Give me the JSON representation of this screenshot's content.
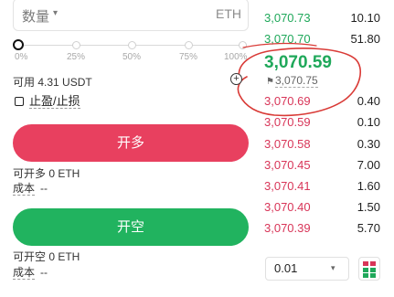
{
  "quantity": {
    "label": "数量",
    "caret": "▾",
    "unit": "ETH"
  },
  "slider": {
    "ticks": [
      "0%",
      "25%",
      "50%",
      "75%",
      "100%"
    ],
    "value_percent": 0
  },
  "available": "可用 4.31 USDT",
  "tpsl": {
    "label": "止盈/止损",
    "checked": false
  },
  "long": {
    "button_label": "开多",
    "can_open": "可开多 0 ETH",
    "cost_label": "成本",
    "cost_value": "--"
  },
  "short": {
    "button_label": "开空",
    "can_open": "可开空 0 ETH",
    "cost_label": "成本",
    "cost_value": "--"
  },
  "orderbook": {
    "asks": [
      {
        "price": "3,070.73",
        "amount": "10.10"
      },
      {
        "price": "3,070.70",
        "amount": "51.80"
      }
    ],
    "last_price": "3,070.59",
    "mark_price": "3,070.75",
    "bids": [
      {
        "price": "3,070.69",
        "amount": "0.40"
      },
      {
        "price": "3,070.59",
        "amount": "0.10"
      },
      {
        "price": "3,070.58",
        "amount": "0.30"
      },
      {
        "price": "3,070.45",
        "amount": "7.00"
      },
      {
        "price": "3,070.41",
        "amount": "1.60"
      },
      {
        "price": "3,070.40",
        "amount": "1.50"
      },
      {
        "price": "3,070.39",
        "amount": "5.70"
      }
    ],
    "precision": "0.01",
    "precision_caret": "▾"
  },
  "colors": {
    "bid_red": "#d83558",
    "ask_green": "#1fa85a",
    "long_button": "#e8405f",
    "short_button": "#21b35f",
    "annotation": "#d93a36"
  },
  "icons": {
    "plus": "plus-circle-icon",
    "flag": "flag-icon",
    "layout": "orderbook-layout-icon",
    "checkbox": "checkbox-icon"
  }
}
